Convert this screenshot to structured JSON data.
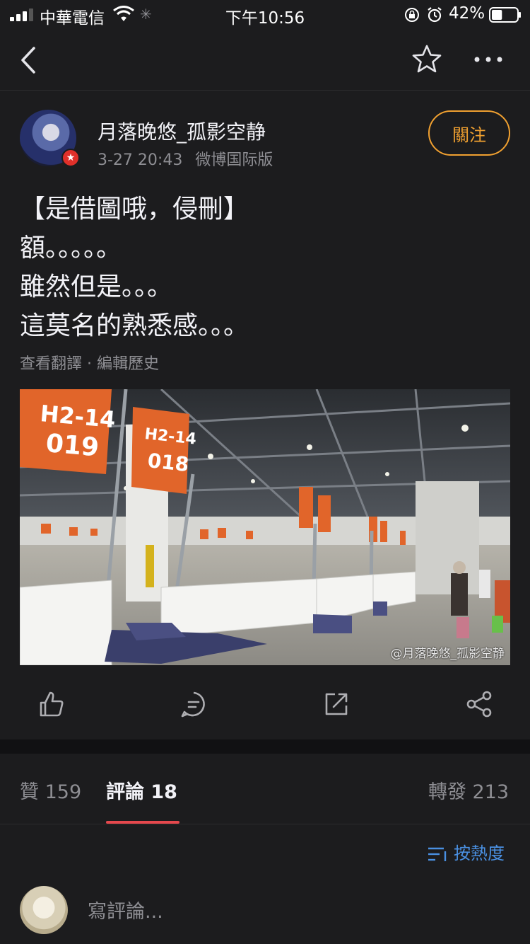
{
  "status_bar": {
    "carrier": "中華電信",
    "time": "下午10:56",
    "battery_percent": "42%",
    "battery_level": 0.42
  },
  "nav": {
    "back_icon": "chevron-left-icon",
    "favorite_icon": "star-icon",
    "more_icon": "ellipsis-icon"
  },
  "post": {
    "author": "月落晚悠_孤影空静",
    "timestamp": "3-27 20:43",
    "source": "微博国际版",
    "follow_label": "關注",
    "lines": [
      "【是借圖哦，侵刪】",
      "額。。。。。",
      "雖然但是。。。",
      "這莫名的熟悉感。。。"
    ],
    "links": "查看翻譯 · 編輯歷史",
    "image": {
      "signs": [
        "H2-14",
        "019",
        "H2-14",
        "018"
      ],
      "watermark": "@月落晚悠_孤影空静"
    }
  },
  "actions": {
    "like_icon": "thumbs-up-icon",
    "comment_icon": "comment-icon",
    "repost_icon": "share-out-icon",
    "share_icon": "share-nodes-icon"
  },
  "tabs": {
    "likes": "贊 159",
    "comments": "評論 18",
    "reposts": "轉發 213"
  },
  "sort_label": "按熱度",
  "comment_placeholder": "寫評論..."
}
